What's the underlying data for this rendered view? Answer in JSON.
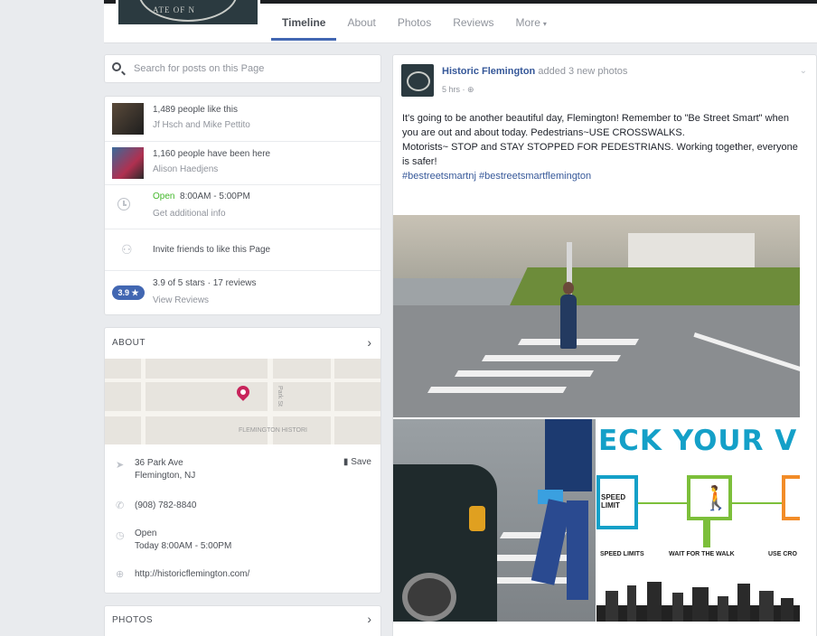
{
  "page": {
    "seal_text": "ATE OF N"
  },
  "tabs": [
    {
      "label": "Timeline"
    },
    {
      "label": "About"
    },
    {
      "label": "Photos"
    },
    {
      "label": "Reviews"
    },
    {
      "label": "More"
    }
  ],
  "search": {
    "placeholder": "Search for posts on this Page"
  },
  "info": {
    "likes": {
      "text": "1,489 people like this",
      "sub": "Jf Hsch and Mike Pettito"
    },
    "visits": {
      "text": "1,160 people have been here",
      "sub": "Alison Haedjens"
    },
    "hours": {
      "status": "Open",
      "time": "8:00AM - 5:00PM",
      "sub": "Get additional info"
    },
    "invite": {
      "text": "Invite friends to like this Page"
    },
    "rating": {
      "badge": "3.9 ★",
      "text": "3.9 of 5 stars · 17 reviews",
      "sub": "View Reviews"
    }
  },
  "about": {
    "heading": "ABOUT",
    "map_labels": {
      "street": "Park St",
      "town": "FLEMINGTON HISTORI"
    },
    "address_line1": "36 Park Ave",
    "address_line2": "Flemington, NJ",
    "save_label": "Save",
    "phone": "(908) 782-8840",
    "hours_status": "Open",
    "hours_today": "Today 8:00AM - 5:00PM",
    "website": "http://historicflemington.com/"
  },
  "photos_section": {
    "heading": "PHOTOS"
  },
  "post": {
    "author": "Historic Flemington",
    "action": "added 3 new photos",
    "time": "5 hrs",
    "text_line1": "It's going to be another beautiful day, Flemington! Remember to \"Be Street Smart\" when you are out and about today. Pedestrians~USE CROSSWALKS.",
    "text_line2": "Motorists~ STOP and STAY STOPPED FOR PEDESTRIANS. Working together, everyone is safer!",
    "hashtags": "#bestreetsmartnj #bestreetsmartflemington"
  },
  "infographic": {
    "title": "ECK YOUR VITA",
    "speed_sign": "SPEED LIMIT",
    "captions": [
      "SPEED LIMITS",
      "WAIT FOR THE WALK",
      "USE CRO"
    ]
  },
  "colors": {
    "accent": "#4267b2",
    "link": "#365899",
    "open_green": "#42b72a",
    "infographic_blue": "#14a0c8",
    "infographic_green": "#7cbf3a",
    "infographic_orange": "#f28c28"
  }
}
